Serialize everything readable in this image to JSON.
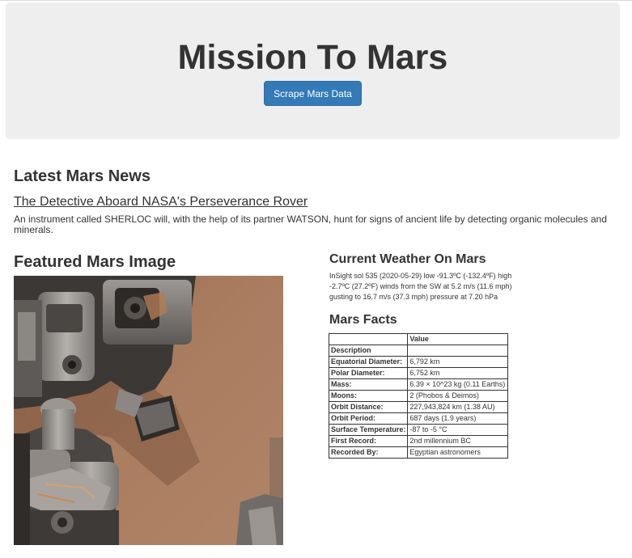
{
  "header": {
    "title": "Mission To Mars",
    "scrape_button": "Scrape Mars Data"
  },
  "news": {
    "heading": "Latest Mars News",
    "title": "The Detective Aboard NASA's Perseverance Rover",
    "teaser": "An instrument called SHERLOC will, with the help of its partner WATSON, hunt for signs of ancient life by detecting organic molecules and minerals."
  },
  "featured": {
    "heading": "Featured Mars Image"
  },
  "weather": {
    "heading": "Current Weather On Mars",
    "text": "InSight sol 535 (2020-05-29) low -91.3ºC (-132.4ºF) high -2.7ºC (27.2ºF) winds from the SW at 5.2 m/s (11.6 mph) gusting to 16.7 m/s (37.3 mph) pressure at 7.20 hPa"
  },
  "facts": {
    "heading": "Mars Facts",
    "value_header": "Value",
    "index_header": "Description",
    "rows": [
      {
        "key": "Equatorial Diameter:",
        "value": "6,792 km"
      },
      {
        "key": "Polar Diameter:",
        "value": "6,752 km"
      },
      {
        "key": "Mass:",
        "value": "6.39 × 10^23 kg (0.11 Earths)"
      },
      {
        "key": "Moons:",
        "value": "2 (Phobos & Deimos)"
      },
      {
        "key": "Orbit Distance:",
        "value": "227,943,824 km (1.38 AU)"
      },
      {
        "key": "Orbit Period:",
        "value": "687 days (1.9 years)"
      },
      {
        "key": "Surface Temperature:",
        "value": "-87 to -5 °C"
      },
      {
        "key": "First Record:",
        "value": "2nd millennium BC"
      },
      {
        "key": "Recorded By:",
        "value": "Egyptian astronomers"
      }
    ]
  },
  "colors": {
    "jumbotron_bg": "#eeeeee",
    "button_bg": "#337ab7",
    "text": "#333333",
    "mars_surface": "#a97b5c"
  }
}
